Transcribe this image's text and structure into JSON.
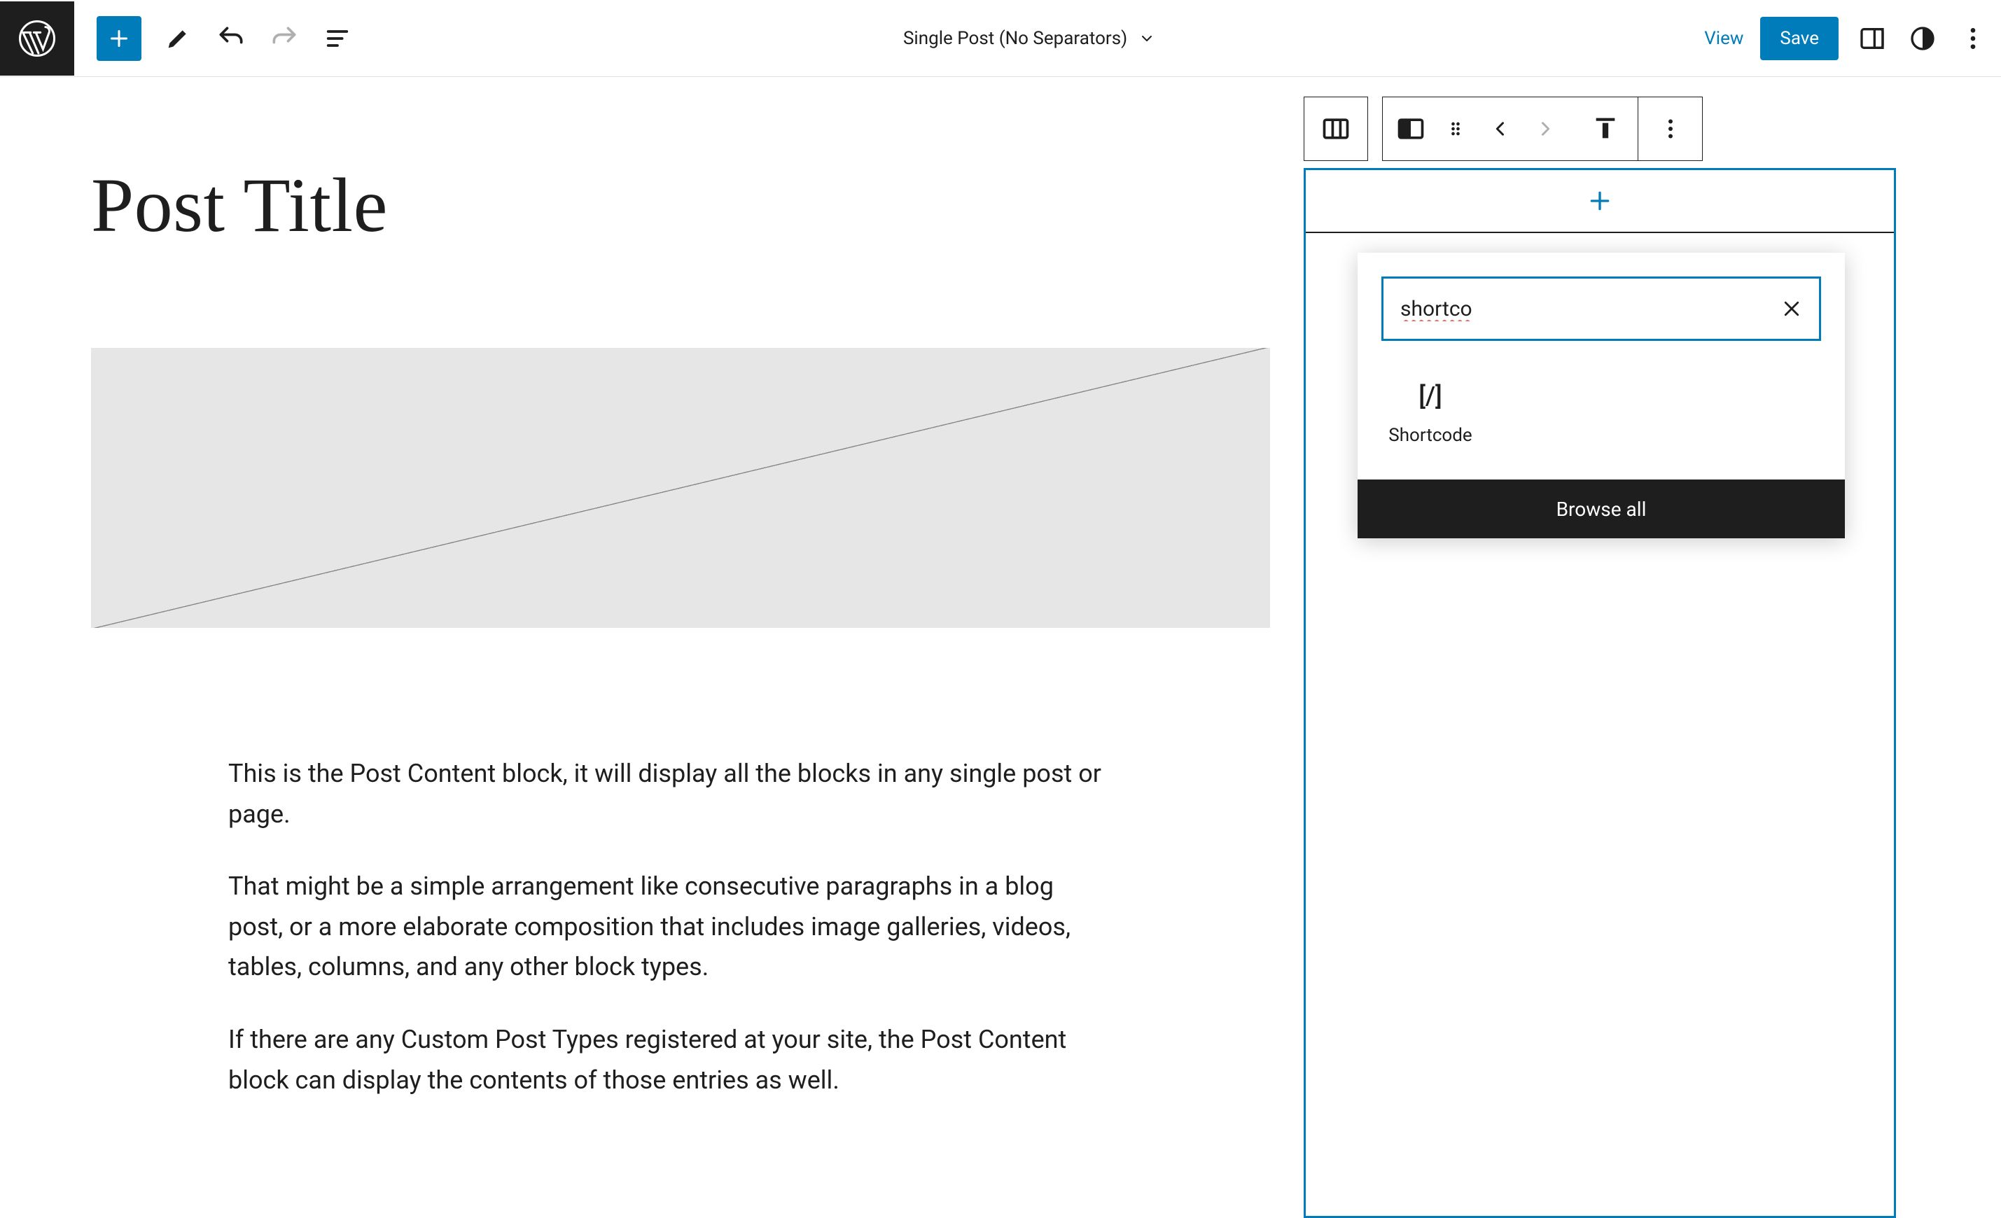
{
  "header": {
    "template_name": "Single Post (No Separators)",
    "view_label": "View",
    "save_label": "Save"
  },
  "icons": {
    "wp_logo": "wordpress-logo-icon",
    "add": "plus-icon",
    "edit": "pencil-icon",
    "undo": "undo-icon",
    "redo": "redo-icon",
    "list_view": "list-view-icon",
    "settings_panel": "sidebar-toggle-icon",
    "styles": "styles-half-circle-icon",
    "more": "more-vertical-icon",
    "columns": "columns-icon",
    "column_half": "column-layout-icon",
    "drag": "drag-handle-icon",
    "move_prev": "chevron-left-icon",
    "move_next": "chevron-right-icon",
    "align_top": "align-top-icon",
    "block_more": "more-vertical-icon"
  },
  "content": {
    "post_title": "Post Title",
    "paragraphs": [
      "This is the Post Content block, it will display all the blocks in any single post or page.",
      "That might be a simple arrangement like consecutive paragraphs in a blog post, or a more elaborate composition that includes image galleries, videos, tables, columns, and any other block types.",
      "If there are any Custom Post Types registered at your site, the Post Content block can display the contents of those entries as well."
    ]
  },
  "inserter": {
    "search_value": "shortco",
    "clear_label": "×",
    "results": [
      {
        "icon": "[/]",
        "label": "Shortcode",
        "name": "shortcode"
      }
    ],
    "browse_all_label": "Browse all"
  },
  "colors": {
    "accent": "#007cba",
    "ink": "#1e1e1e"
  }
}
